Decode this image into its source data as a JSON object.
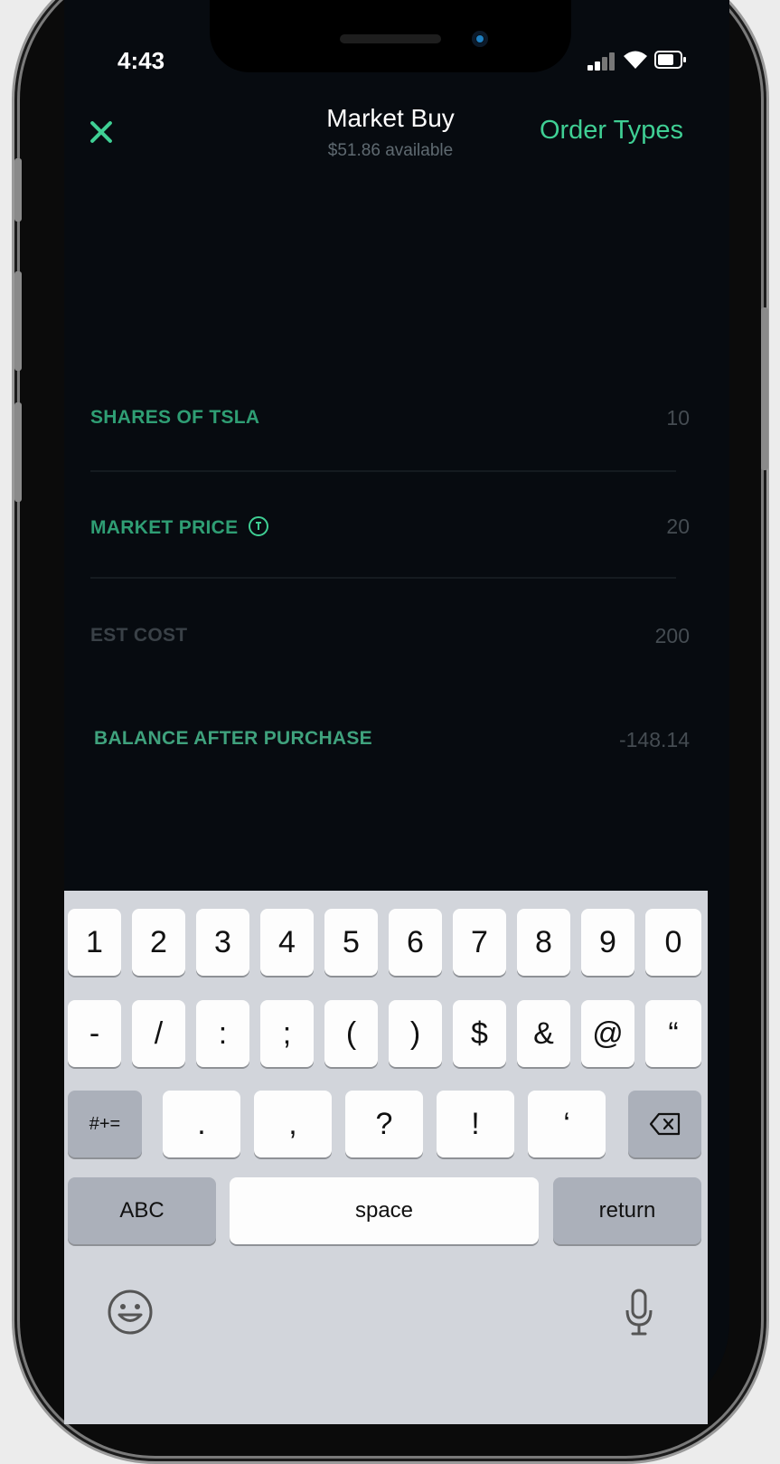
{
  "status_bar": {
    "time": "4:43"
  },
  "header": {
    "title": "Market Buy",
    "subtitle": "$51.86 available",
    "order_types": "Order Types"
  },
  "rows": [
    {
      "label": "SHARES OF TSLA",
      "value": "10"
    },
    {
      "label": "MARKET PRICE",
      "value": "20"
    },
    {
      "label": "EST COST",
      "value": "200"
    },
    {
      "label": "BALANCE AFTER PURCHASE",
      "value": "-148.14"
    }
  ],
  "keyboard": {
    "row1": [
      "1",
      "2",
      "3",
      "4",
      "5",
      "6",
      "7",
      "8",
      "9",
      "0"
    ],
    "row2": [
      "-",
      "/",
      ":",
      ";",
      "(",
      ")",
      "$",
      "&",
      "@",
      "“"
    ],
    "row3": [
      ".",
      ",",
      "?",
      "!",
      "‘"
    ],
    "symbols_key": "#+=",
    "abc_key": "ABC",
    "space_key": "space",
    "return_key": "return"
  },
  "colors": {
    "accent": "#3fcf94",
    "label_green": "#2f9e74",
    "background": "#070b10",
    "keyboard_bg": "#d2d5db"
  }
}
